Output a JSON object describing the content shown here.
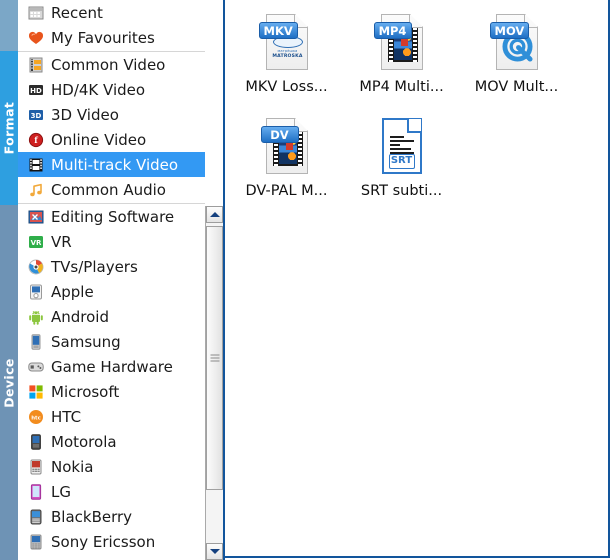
{
  "tabs": [
    {
      "id": "format",
      "label": "Format",
      "active": true,
      "color": "#2e9fe0"
    },
    {
      "id": "device",
      "label": "Device",
      "active": false,
      "color": "#6e93b5"
    }
  ],
  "sidebar": {
    "groups": [
      {
        "items": [
          {
            "label": "Recent",
            "icon": "recent-icon",
            "selected": false
          },
          {
            "label": "My Favourites",
            "icon": "heart-icon",
            "selected": false
          }
        ]
      },
      {
        "items": [
          {
            "label": "Common Video",
            "icon": "film-strip-icon",
            "selected": false
          },
          {
            "label": "HD/4K Video",
            "icon": "hd-icon",
            "selected": false
          },
          {
            "label": "3D Video",
            "icon": "3d-icon",
            "selected": false
          },
          {
            "label": "Online Video",
            "icon": "online-video-icon",
            "selected": false
          },
          {
            "label": "Multi-track Video",
            "icon": "multitrack-film-icon",
            "selected": true
          },
          {
            "label": "Common Audio",
            "icon": "music-note-icon",
            "selected": false
          }
        ]
      },
      {
        "items": [
          {
            "label": "Editing Software",
            "icon": "editing-software-icon",
            "selected": false
          },
          {
            "label": "VR",
            "icon": "vr-icon",
            "selected": false
          },
          {
            "label": "TVs/Players",
            "icon": "tv-players-icon",
            "selected": false
          },
          {
            "label": "Apple",
            "icon": "apple-device-icon",
            "selected": false
          },
          {
            "label": "Android",
            "icon": "android-icon",
            "selected": false
          },
          {
            "label": "Samsung",
            "icon": "samsung-icon",
            "selected": false
          },
          {
            "label": "Game Hardware",
            "icon": "gamepad-icon",
            "selected": false
          },
          {
            "label": "Microsoft",
            "icon": "microsoft-icon",
            "selected": false
          },
          {
            "label": "HTC",
            "icon": "htc-icon",
            "selected": false
          },
          {
            "label": "Motorola",
            "icon": "motorola-icon",
            "selected": false
          },
          {
            "label": "Nokia",
            "icon": "nokia-icon",
            "selected": false
          },
          {
            "label": "LG",
            "icon": "lg-icon",
            "selected": false
          },
          {
            "label": "BlackBerry",
            "icon": "blackberry-icon",
            "selected": false
          },
          {
            "label": "Sony Ericsson",
            "icon": "sony-ericsson-icon",
            "selected": false
          }
        ]
      }
    ],
    "scrollbar": {
      "up_arrow": "scroll-up-arrow",
      "down_arrow": "scroll-down-arrow",
      "thumb": "scroll-thumb"
    }
  },
  "formats": [
    {
      "badge": "MKV",
      "label": "MKV Loss...",
      "art": "matroska"
    },
    {
      "badge": "MP4",
      "label": "MP4 Multi...",
      "art": "film"
    },
    {
      "badge": "MOV",
      "label": "MOV Mult...",
      "art": "quicktime"
    },
    {
      "badge": "DV",
      "label": "DV-PAL M...",
      "art": "film"
    },
    {
      "badge": "SRT",
      "label": "SRT subti...",
      "art": "subtitle"
    }
  ],
  "colors": {
    "selection": "#3399f3",
    "tab_active": "#2e9fe0",
    "tab_inactive": "#6e93b5",
    "panel_border": "#12559c",
    "badge_blue": "#1f6fc4"
  }
}
